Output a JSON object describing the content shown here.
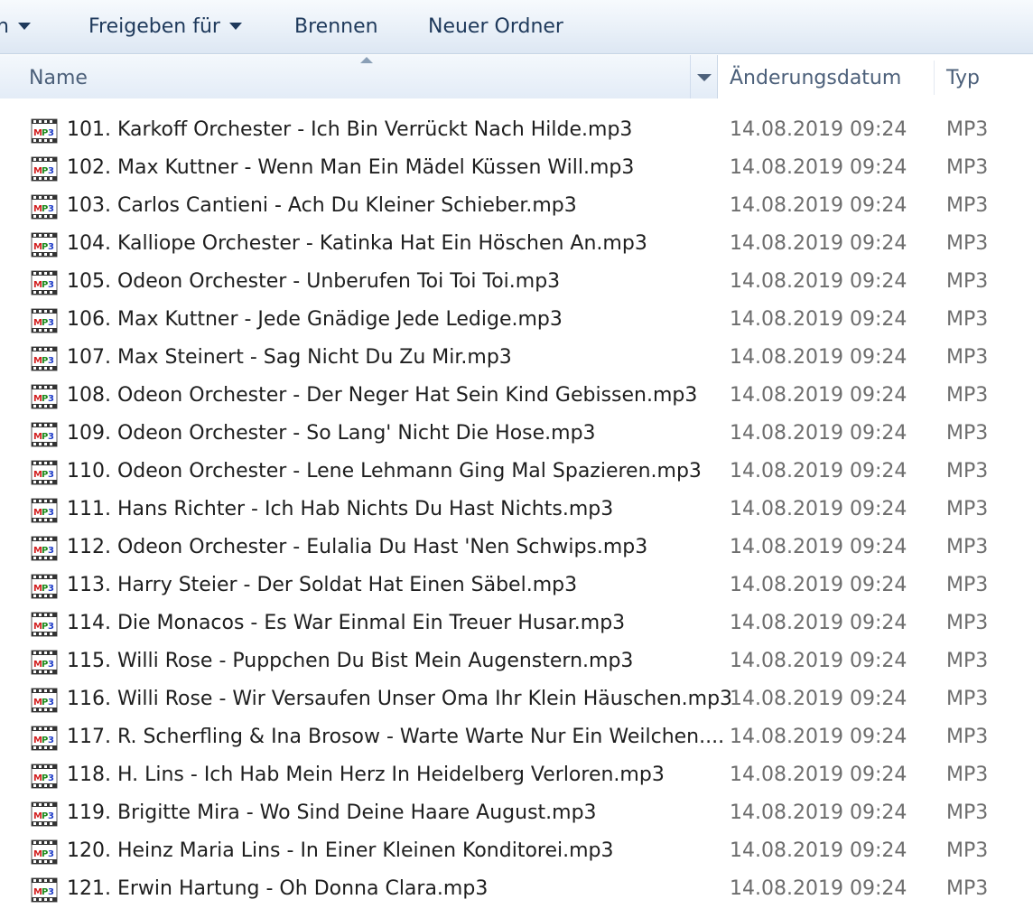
{
  "toolbar": {
    "organize_fragment": "n",
    "share_label": "Freigeben für",
    "burn_label": "Brennen",
    "new_folder_label": "Neuer Ordner"
  },
  "columns": {
    "name": "Name",
    "date": "Änderungsdatum",
    "type": "Typ",
    "sort_indicator": "ascending"
  },
  "file_icon": "mp3-file-icon",
  "files": [
    {
      "name": "101. Karkoff Orchester - Ich Bin Verrückt Nach Hilde.mp3",
      "date": "14.08.2019 09:24",
      "type": "MP3"
    },
    {
      "name": "102. Max Kuttner - Wenn Man Ein Mädel Küssen Will.mp3",
      "date": "14.08.2019 09:24",
      "type": "MP3"
    },
    {
      "name": "103. Carlos Cantieni - Ach Du Kleiner Schieber.mp3",
      "date": "14.08.2019 09:24",
      "type": "MP3"
    },
    {
      "name": "104. Kalliope Orchester - Katinka Hat Ein Höschen An.mp3",
      "date": "14.08.2019 09:24",
      "type": "MP3"
    },
    {
      "name": "105. Odeon Orchester - Unberufen Toi Toi Toi.mp3",
      "date": "14.08.2019 09:24",
      "type": "MP3"
    },
    {
      "name": "106. Max Kuttner - Jede Gnädige Jede Ledige.mp3",
      "date": "14.08.2019 09:24",
      "type": "MP3"
    },
    {
      "name": "107. Max Steinert - Sag Nicht Du Zu Mir.mp3",
      "date": "14.08.2019 09:24",
      "type": "MP3"
    },
    {
      "name": "108. Odeon Orchester - Der Neger Hat Sein Kind Gebissen.mp3",
      "date": "14.08.2019 09:24",
      "type": "MP3"
    },
    {
      "name": "109. Odeon Orchester - So Lang' Nicht Die Hose.mp3",
      "date": "14.08.2019 09:24",
      "type": "MP3"
    },
    {
      "name": "110. Odeon Orchester - Lene Lehmann Ging Mal Spazieren.mp3",
      "date": "14.08.2019 09:24",
      "type": "MP3"
    },
    {
      "name": "111. Hans Richter - Ich Hab Nichts Du Hast Nichts.mp3",
      "date": "14.08.2019 09:24",
      "type": "MP3"
    },
    {
      "name": "112. Odeon Orchester - Eulalia Du Hast 'Nen Schwips.mp3",
      "date": "14.08.2019 09:24",
      "type": "MP3"
    },
    {
      "name": "113. Harry Steier - Der Soldat Hat Einen Säbel.mp3",
      "date": "14.08.2019 09:24",
      "type": "MP3"
    },
    {
      "name": "114. Die Monacos - Es War Einmal Ein Treuer Husar.mp3",
      "date": "14.08.2019 09:24",
      "type": "MP3"
    },
    {
      "name": "115. Willi Rose - Puppchen Du Bist Mein Augenstern.mp3",
      "date": "14.08.2019 09:24",
      "type": "MP3"
    },
    {
      "name": "116. Willi Rose - Wir Versaufen Unser Oma Ihr Klein Häuschen.mp3",
      "date": "14.08.2019 09:24",
      "type": "MP3"
    },
    {
      "name": "117. R. Scherfling & Ina Brosow - Warte Warte Nur Ein Weilchen....",
      "date": "14.08.2019 09:24",
      "type": "MP3"
    },
    {
      "name": "118. H. Lins - Ich Hab Mein Herz In Heidelberg Verloren.mp3",
      "date": "14.08.2019 09:24",
      "type": "MP3"
    },
    {
      "name": "119. Brigitte Mira - Wo Sind Deine Haare August.mp3",
      "date": "14.08.2019 09:24",
      "type": "MP3"
    },
    {
      "name": "120. Heinz Maria Lins - In Einer Kleinen Konditorei.mp3",
      "date": "14.08.2019 09:24",
      "type": "MP3"
    },
    {
      "name": "121. Erwin Hartung - Oh Donna Clara.mp3",
      "date": "14.08.2019 09:24",
      "type": "MP3"
    }
  ]
}
